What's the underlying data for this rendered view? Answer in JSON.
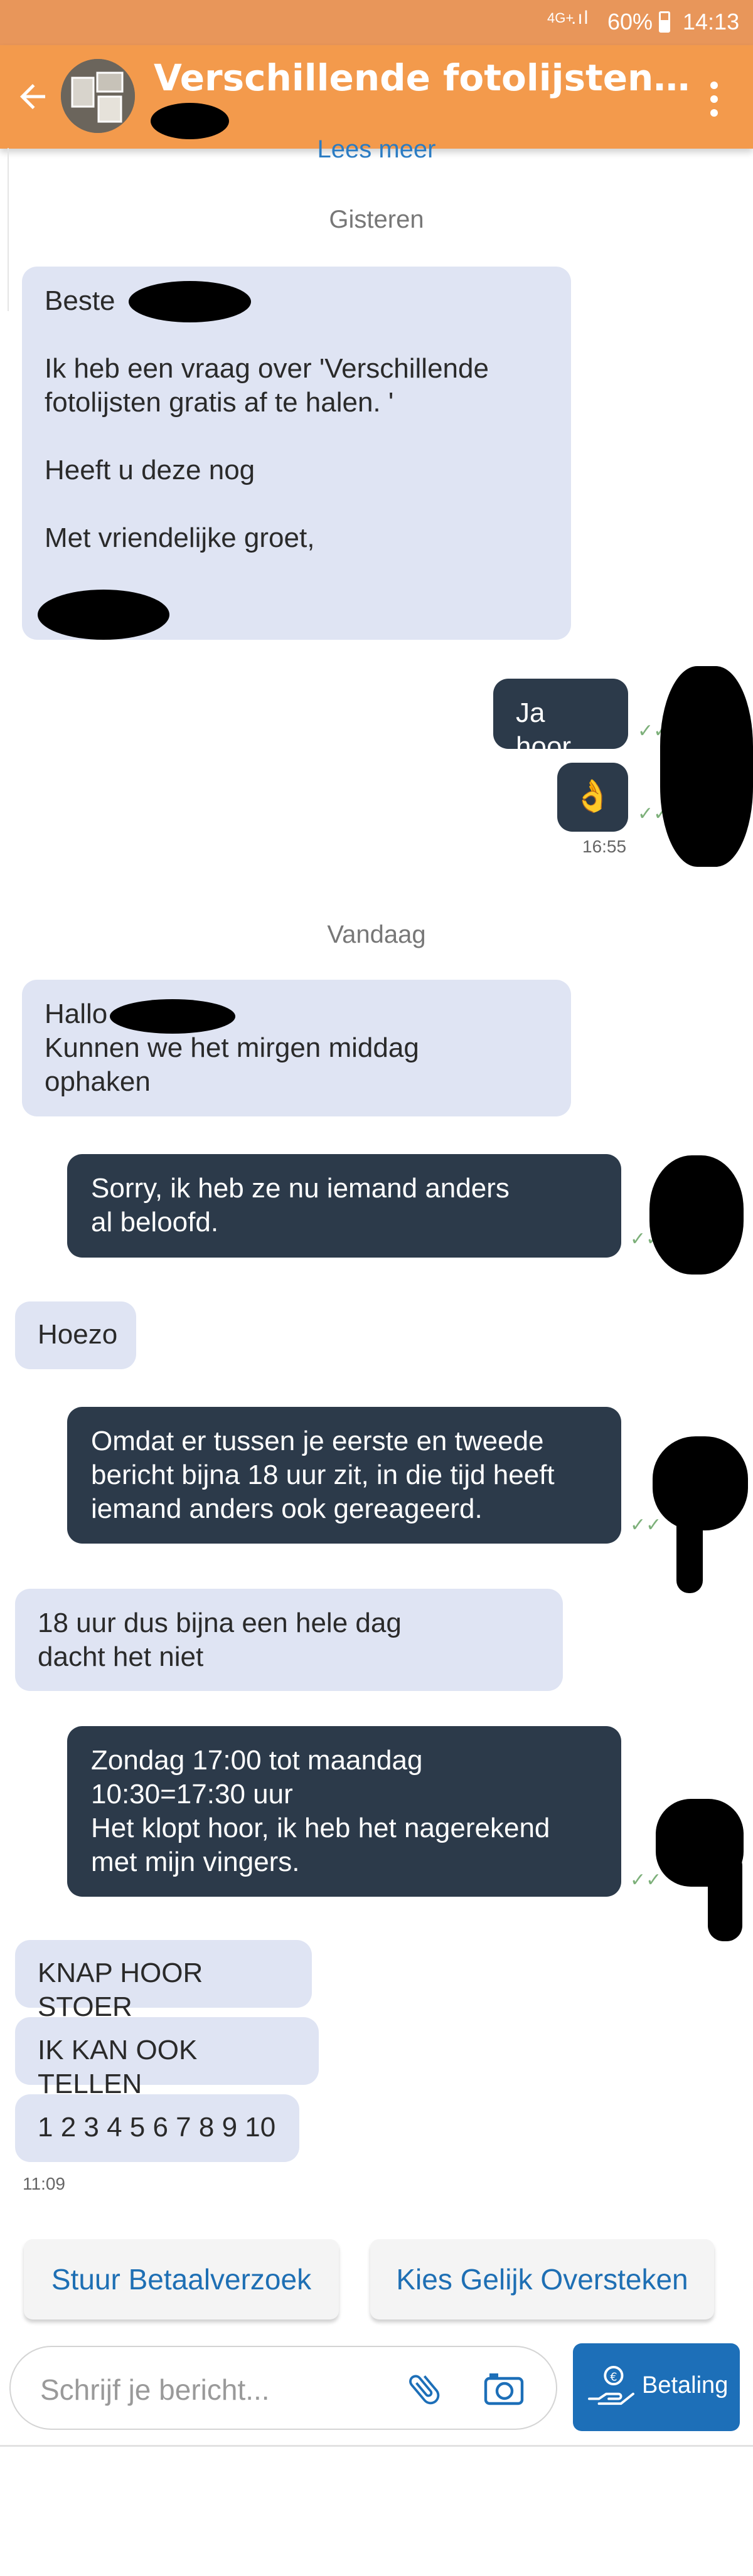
{
  "status_bar": {
    "network": "4G+",
    "battery": "60%",
    "time": "14:13"
  },
  "header": {
    "title": "Verschillende fotolijsten grat..."
  },
  "chat": {
    "read_more": "Lees meer",
    "day_yesterday": "Gisteren",
    "day_today": "Vandaag",
    "msg1": {
      "greeting": "Beste",
      "line1": "Ik heb een vraag over 'Verschillende",
      "line2": "fotolijsten gratis af te halen. '",
      "line3": "Heeft u deze nog",
      "line4": "Met vriendelijke groet,"
    },
    "msg2": "Ja hoor",
    "msg3_emoji": "👌",
    "time1": "16:55",
    "msg4": {
      "line1": "Hallo",
      "line2": "Kunnen we het mirgen middag",
      "line3": "ophaken"
    },
    "msg5": {
      "line1": "Sorry, ik heb ze nu iemand anders",
      "line2": "al beloofd."
    },
    "msg6": "Hoezo",
    "msg7": {
      "line1": "Omdat er tussen je eerste en tweede",
      "line2": "bericht bijna 18 uur zit, in die tijd heeft",
      "line3": "iemand anders ook gereageerd."
    },
    "msg8": {
      "line1": "18 uur dus bijna een hele dag",
      "line2": "dacht het niet"
    },
    "msg9": {
      "line1": "Zondag 17:00 tot maandag",
      "line2": "10:30=17:30 uur",
      "line3": "Het klopt hoor, ik heb het nagerekend",
      "line4": "met mijn vingers."
    },
    "msg10": "KNAP HOOR STOER",
    "msg11": "IK KAN OOK TELLEN",
    "msg12": "1 2 3 4 5 6 7 8 9 10",
    "time2": "11:09",
    "ticks": "✓✓"
  },
  "quick_actions": {
    "request_payment": "Stuur Betaalverzoek",
    "swap": "Kies Gelijk Oversteken"
  },
  "composer": {
    "placeholder": "Schrijf je bericht...",
    "payment_label": "Betaling"
  },
  "colors": {
    "header": "#f39a4c",
    "incoming": "#dfe4f3",
    "outgoing": "#2c3a4a",
    "accent": "#1d6fb8"
  },
  "icons": [
    "back-arrow-icon",
    "overflow-menu-icon",
    "paperclip-icon",
    "camera-icon",
    "payment-hand-icon"
  ]
}
